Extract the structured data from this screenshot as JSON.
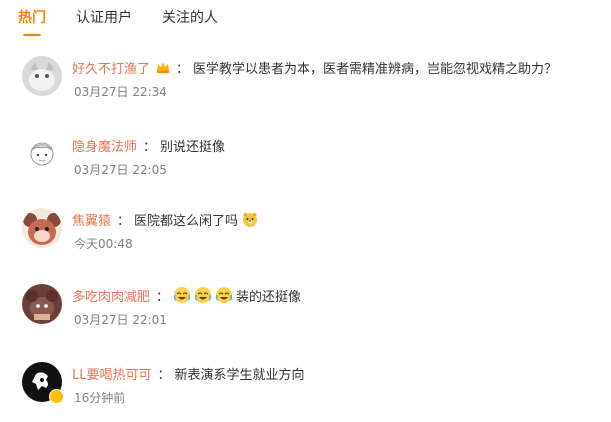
{
  "tabs": [
    {
      "label": "热门",
      "active": true
    },
    {
      "label": "认证用户",
      "active": false
    },
    {
      "label": "关注的人",
      "active": false
    }
  ],
  "comments": [
    {
      "user": "好久不打渔了",
      "separator": "：",
      "text": "医学教学以患者为本，医者需精准辨病，岂能忽视戏精之助力？",
      "time": "03月27日 22:34",
      "has_badge": true
    },
    {
      "user": "隐身魔法师",
      "separator": "：",
      "text": "别说还挺像",
      "time": "03月27日 22:05"
    },
    {
      "user": "焦翼猿",
      "separator": "：",
      "text": "医院都这么闲了吗",
      "time": "今天00:48",
      "emoji_after": "dog-face-emoji"
    },
    {
      "user": "多吃肉肉减肥",
      "separator": "：",
      "text": "装的还挺像",
      "time": "03月27日 22:01",
      "emojis_before": [
        "laugh-cry-emoji",
        "laugh-cry-emoji",
        "laugh-cry-emoji"
      ]
    },
    {
      "user": "LL要喝热可可",
      "separator": "：",
      "text": "新表演系学生就业方向",
      "time": "16分钟前",
      "verified": true
    }
  ],
  "colors": {
    "accent": "#ff8200",
    "username": "#eb7350",
    "text": "#333333",
    "muted": "#808080"
  }
}
